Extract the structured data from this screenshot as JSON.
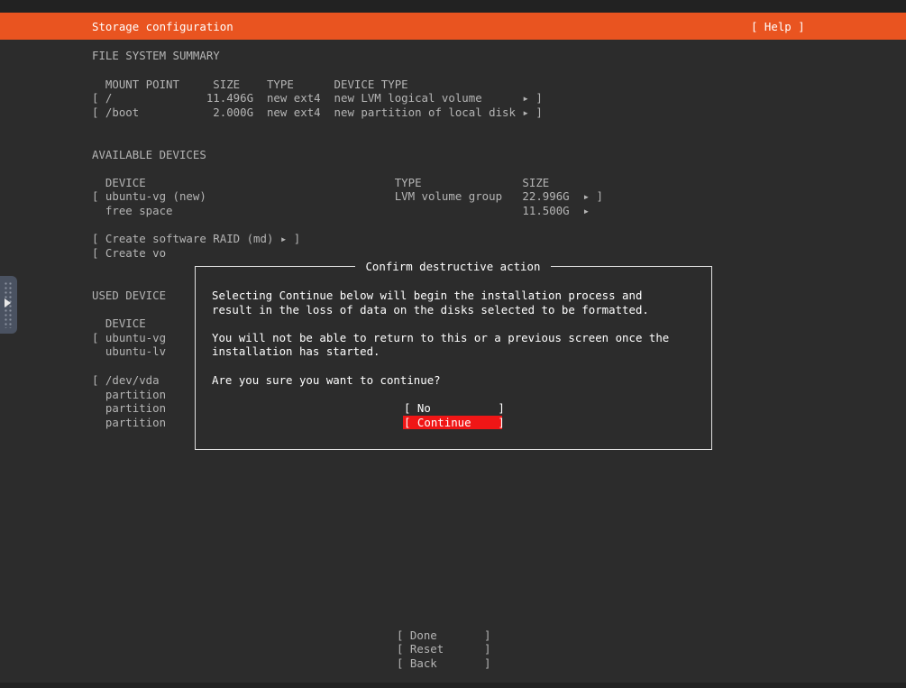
{
  "header": {
    "title": "Storage configuration",
    "help": "[ Help ]"
  },
  "summary": {
    "heading": "FILE SYSTEM SUMMARY",
    "columns": "  MOUNT POINT     SIZE    TYPE      DEVICE TYPE",
    "rows": [
      "[ /              11.496G  new ext4  new LVM logical volume      ▸ ]",
      "[ /boot           2.000G  new ext4  new partition of local disk ▸ ]"
    ]
  },
  "available": {
    "heading": "AVAILABLE DEVICES",
    "columns": "  DEVICE                                     TYPE               SIZE",
    "rows": [
      "[ ubuntu-vg (new)                            LVM volume group   22.996G  ▸ ]",
      "  free space                                                    11.500G  ▸"
    ],
    "actions": [
      "[ Create software RAID (md) ▸ ]",
      "[ Create vo"
    ]
  },
  "used": {
    "heading": "USED DEVICE",
    "columns": "  DEVICE",
    "rows": [
      "[ ubuntu-vg",
      "  ubuntu-lv",
      "",
      "[ /dev/vda",
      "  partition",
      "  partition",
      "  partition"
    ]
  },
  "dialog": {
    "title": " Confirm destructive action ",
    "line1": "Selecting Continue below will begin the installation process and",
    "line2": "result in the loss of data on the disks selected to be formatted.",
    "line3": "You will not be able to return to this or a previous screen once the",
    "line4": "installation has started.",
    "question": "Are you sure you want to continue?",
    "no": "[ No          ]",
    "continue": "[ Continue    ]"
  },
  "footer": {
    "done": "[ Done       ]",
    "reset": "[ Reset      ]",
    "back": "[ Back       ]"
  },
  "colors": {
    "accent": "#e95420",
    "focus": "#f01616",
    "background": "#2c2c2c"
  }
}
